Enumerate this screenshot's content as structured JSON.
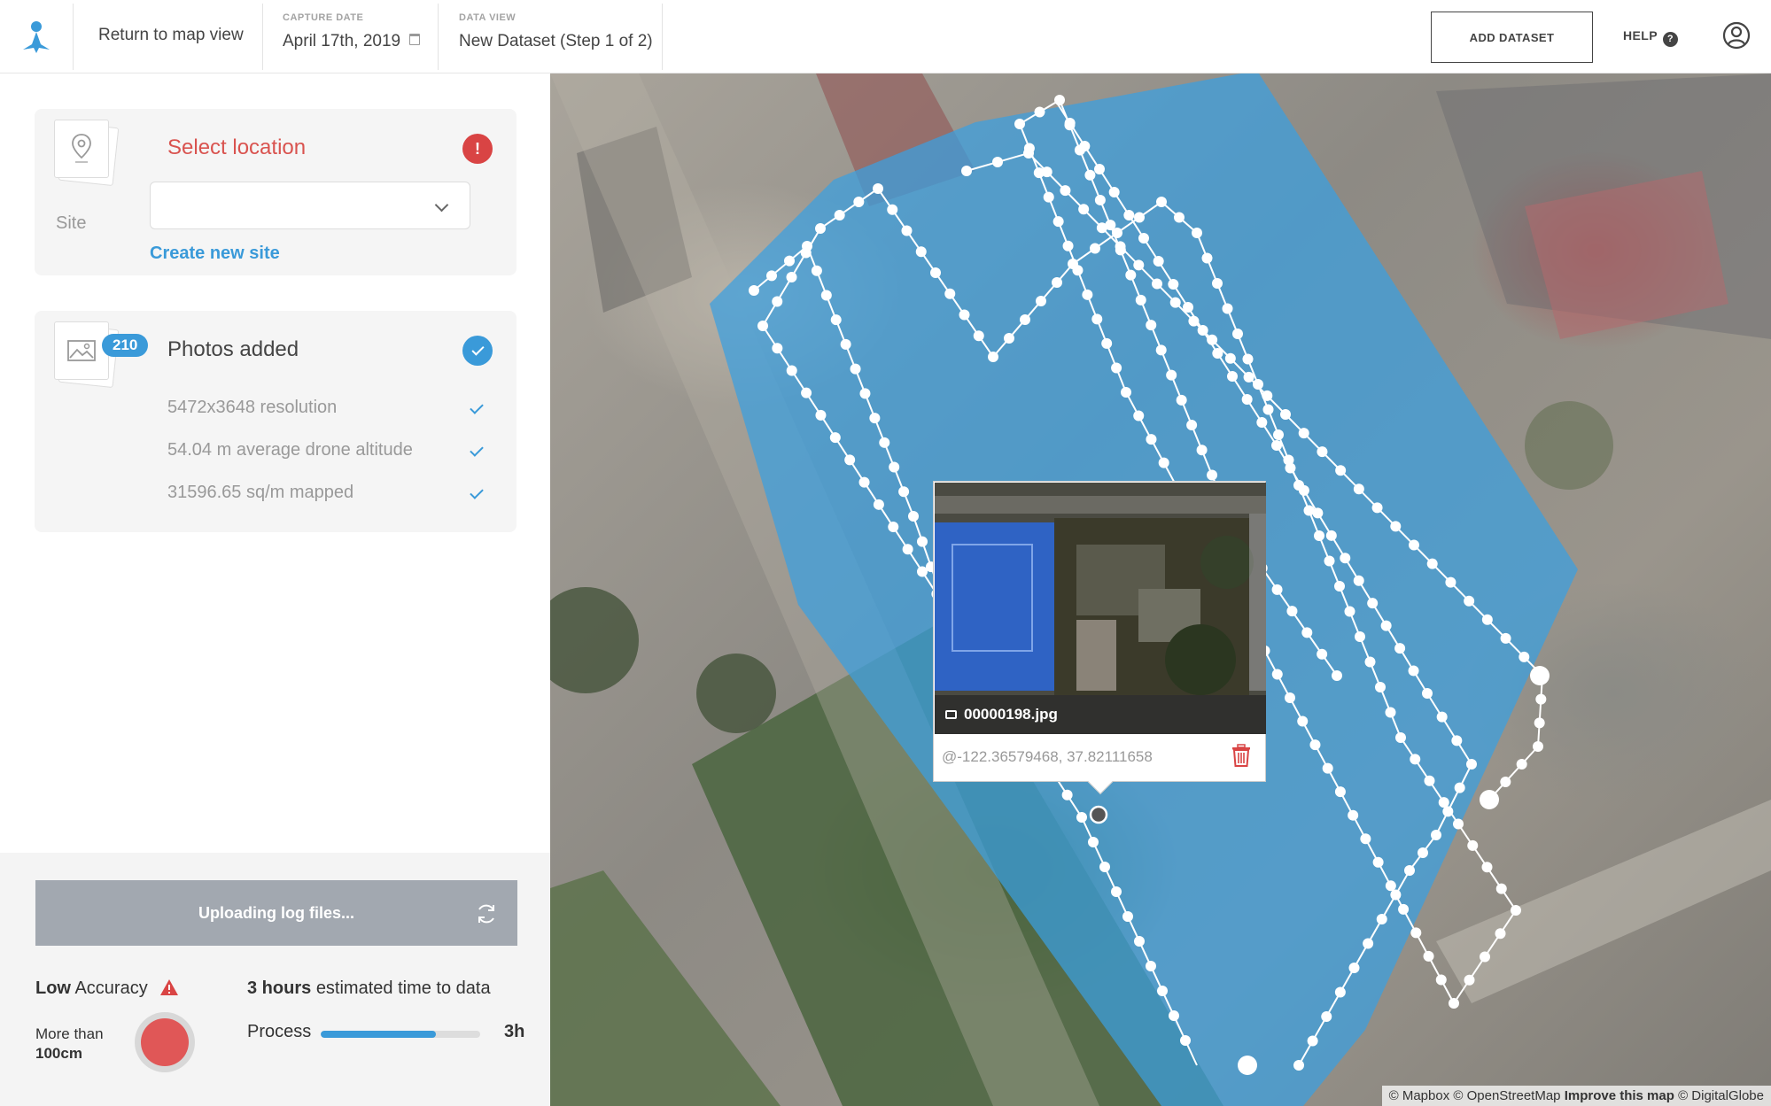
{
  "topbar": {
    "return_label": "Return to map view",
    "capture_date_label": "CAPTURE DATE",
    "capture_date_value": "April 17th, 2019",
    "data_view_label": "DATA VIEW",
    "data_view_value": "New Dataset (Step 1 of 2)",
    "add_dataset_label": "ADD DATASET",
    "help_label": "HELP",
    "help_glyph": "?"
  },
  "location_card": {
    "title": "Select location",
    "error_glyph": "!",
    "site_label": "Site",
    "site_value": "",
    "create_site_label": "Create new site"
  },
  "photos_card": {
    "count": "210",
    "title": "Photos added",
    "stats": [
      "5472x3648 resolution",
      "54.04 m average drone altitude",
      "31596.65 sq/m mapped"
    ]
  },
  "status": {
    "upload_label": "Uploading log files...",
    "accuracy_level": "Low",
    "accuracy_word": "Accuracy",
    "precision_prefix": "More than",
    "precision_value": "100cm",
    "eta_value": "3 hours",
    "eta_suffix": "estimated time to data",
    "process_label": "Process",
    "process_progress": 0.72,
    "process_time": "3h"
  },
  "popup": {
    "filename": "00000198.jpg",
    "coords": "@-122.36579468, 37.82111658"
  },
  "attribution": {
    "mapbox": "© Mapbox",
    "osm": "© OpenStreetMap",
    "improve": "Improve this map",
    "digitalglobe": "© DigitalGlobe"
  },
  "colors": {
    "accent": "#3a9ad9",
    "error": "#d94444",
    "coverage": "#3aa0e0"
  },
  "icons": {
    "logo": "brand-logo-icon",
    "calendar": "calendar-icon",
    "help": "help-circle-icon",
    "user": "user-account-icon",
    "pin": "map-pin-icon",
    "image": "image-icon",
    "refresh": "refresh-icon",
    "warning": "warning-triangle-icon",
    "camera": "camera-icon",
    "trash": "trash-icon"
  }
}
